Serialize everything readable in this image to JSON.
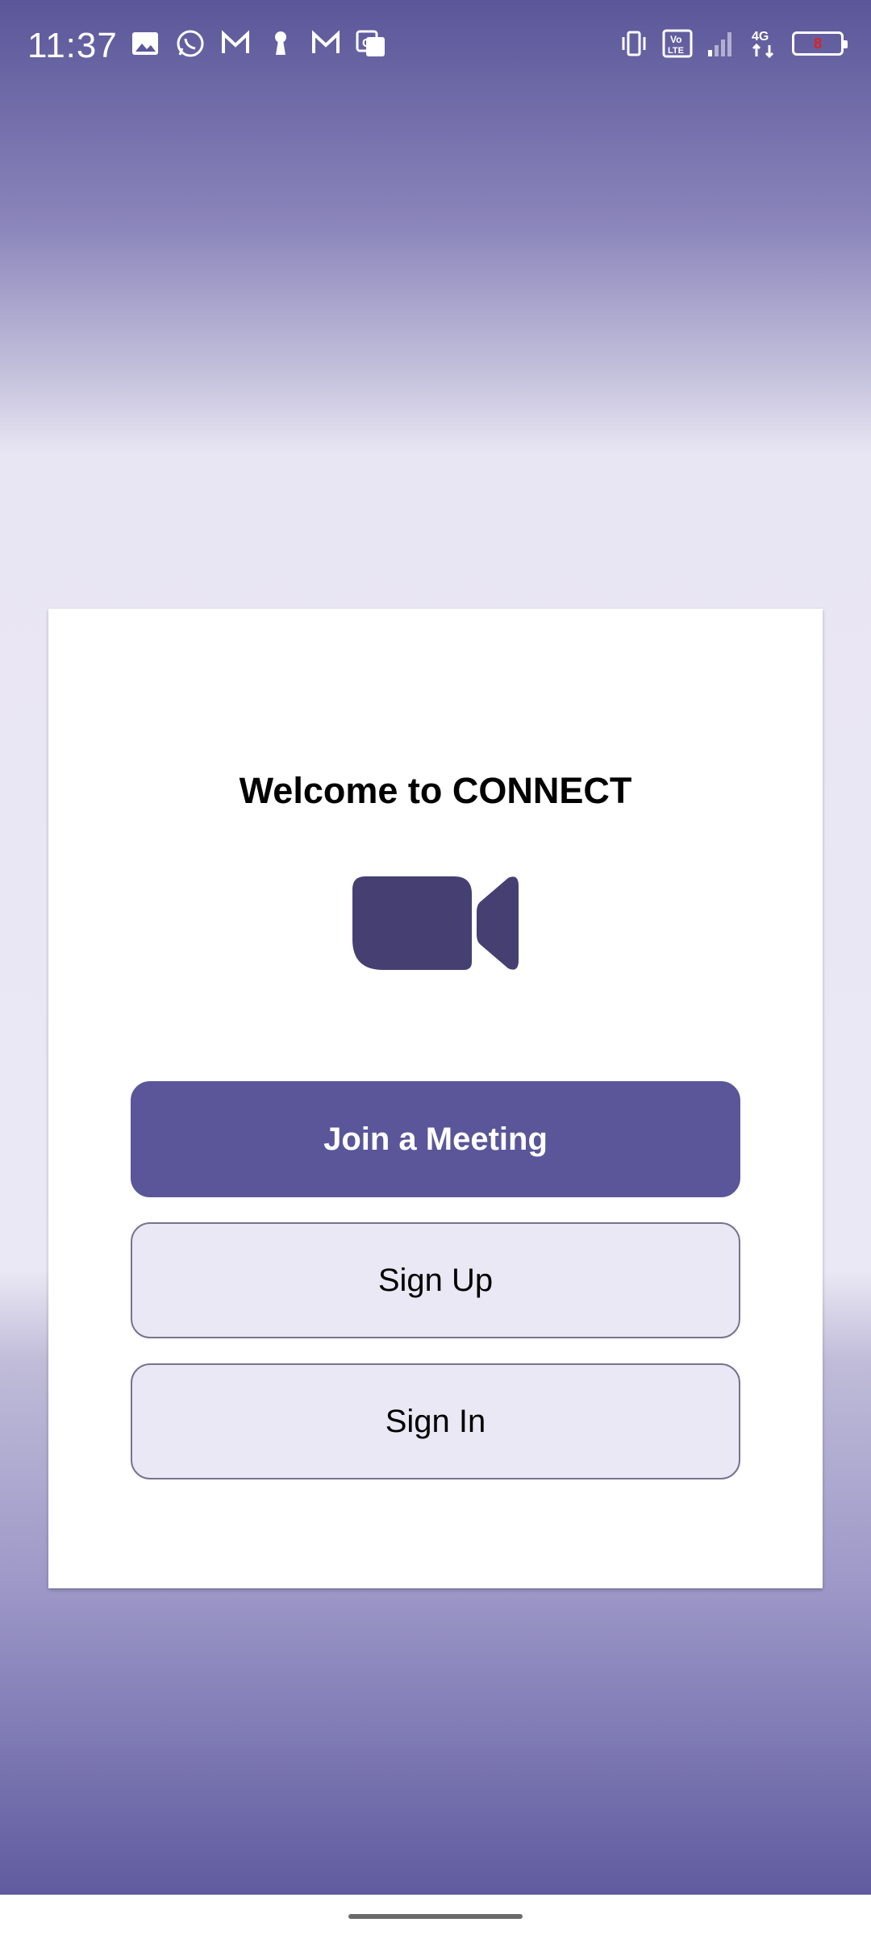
{
  "status_bar": {
    "time": "11:37",
    "left_icons": [
      "gallery-icon",
      "whatsapp-icon",
      "gmail-icon",
      "keyhole-icon",
      "gmail-icon",
      "translate-icon"
    ],
    "right_icons": [
      "vibrate-icon",
      "volte-icon",
      "signal-icon",
      "network-4g-icon",
      "battery-icon"
    ],
    "battery_level": "8",
    "volte_label": "Vo LTE",
    "network_label": "4G"
  },
  "welcome": {
    "title": "Welcome to CONNECT"
  },
  "logo": {
    "icon": "video-camera-icon",
    "color": "#453f72"
  },
  "buttons": {
    "join": "Join a Meeting",
    "sign_up": "Sign Up",
    "sign_in": "Sign In"
  },
  "colors": {
    "primary": "#5a5699",
    "secondary_bg": "#ebe8f5",
    "logo": "#453f72"
  }
}
